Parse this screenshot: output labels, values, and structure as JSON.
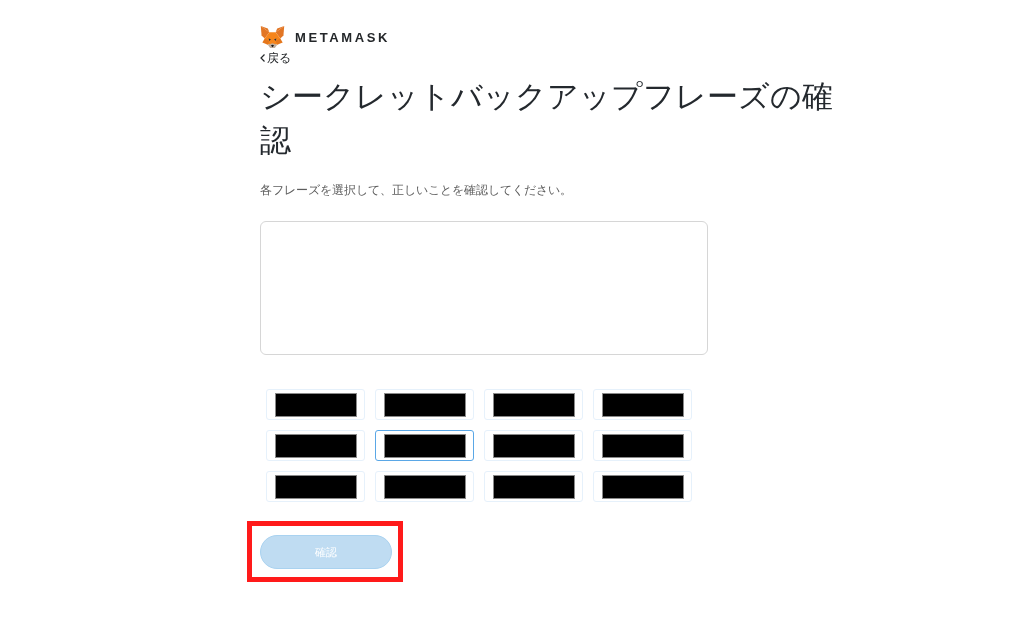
{
  "logo": {
    "wordmark": "METAMASK"
  },
  "back_link": {
    "label": "戻る"
  },
  "title": "シークレットバックアップフレーズの確認",
  "instruction": "各フレーズを選択して、正しいことを確認してください。",
  "word_chips": [
    {
      "redacted": true,
      "selected": false
    },
    {
      "redacted": true,
      "selected": false
    },
    {
      "redacted": true,
      "selected": false
    },
    {
      "redacted": true,
      "selected": false
    },
    {
      "redacted": true,
      "selected": false
    },
    {
      "redacted": true,
      "selected": true
    },
    {
      "redacted": true,
      "selected": false
    },
    {
      "redacted": true,
      "selected": false
    },
    {
      "redacted": true,
      "selected": false
    },
    {
      "redacted": true,
      "selected": false
    },
    {
      "redacted": true,
      "selected": false
    },
    {
      "redacted": true,
      "selected": false
    }
  ],
  "confirm_button": {
    "label": "確認",
    "disabled": true,
    "highlighted": true
  }
}
